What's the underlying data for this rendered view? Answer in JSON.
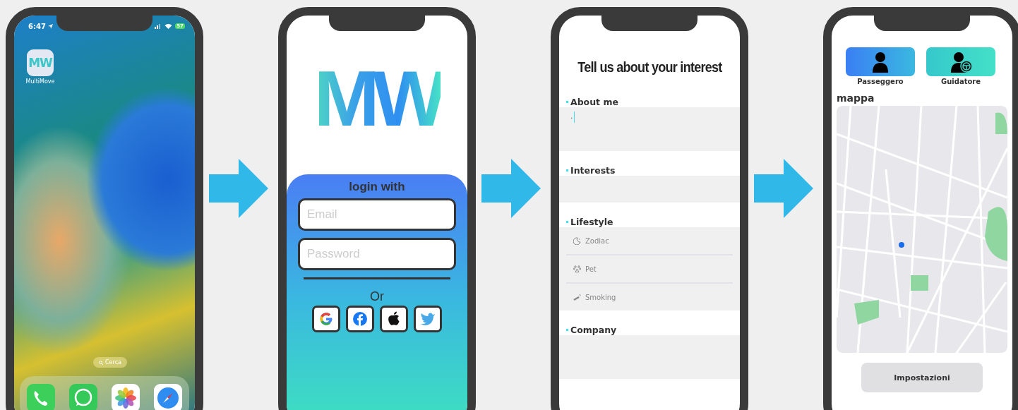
{
  "screens": [
    {
      "kind": "home",
      "status": {
        "time": "6:47",
        "battery": "57"
      },
      "apps": [
        {
          "label": "MultiMove",
          "logo": "MW"
        }
      ],
      "search_pill": "Cerca"
    },
    {
      "kind": "login",
      "logo": "MW",
      "heading": "login with",
      "fields": [
        {
          "placeholder": "Email"
        },
        {
          "placeholder": "Password"
        }
      ],
      "divider_text": "Or"
    },
    {
      "kind": "profile",
      "title": "Tell us about your interest",
      "sections": [
        {
          "label": "About me",
          "kind": "text",
          "value": "."
        },
        {
          "label": "Interests",
          "kind": "text"
        },
        {
          "label": "Lifestyle",
          "kind": "options",
          "options": [
            {
              "label": "Zodiac",
              "kind": "zodiac"
            },
            {
              "label": "Pet",
              "kind": "pet"
            },
            {
              "label": "Smoking",
              "kind": "smoking"
            }
          ]
        },
        {
          "label": "Company",
          "kind": "text"
        }
      ]
    },
    {
      "kind": "map",
      "roles": [
        {
          "label": "Passeggero",
          "kind": "passenger"
        },
        {
          "label": "Guidatore",
          "kind": "driver"
        }
      ],
      "map_title": "mappa",
      "button": "Impostazioni"
    }
  ]
}
